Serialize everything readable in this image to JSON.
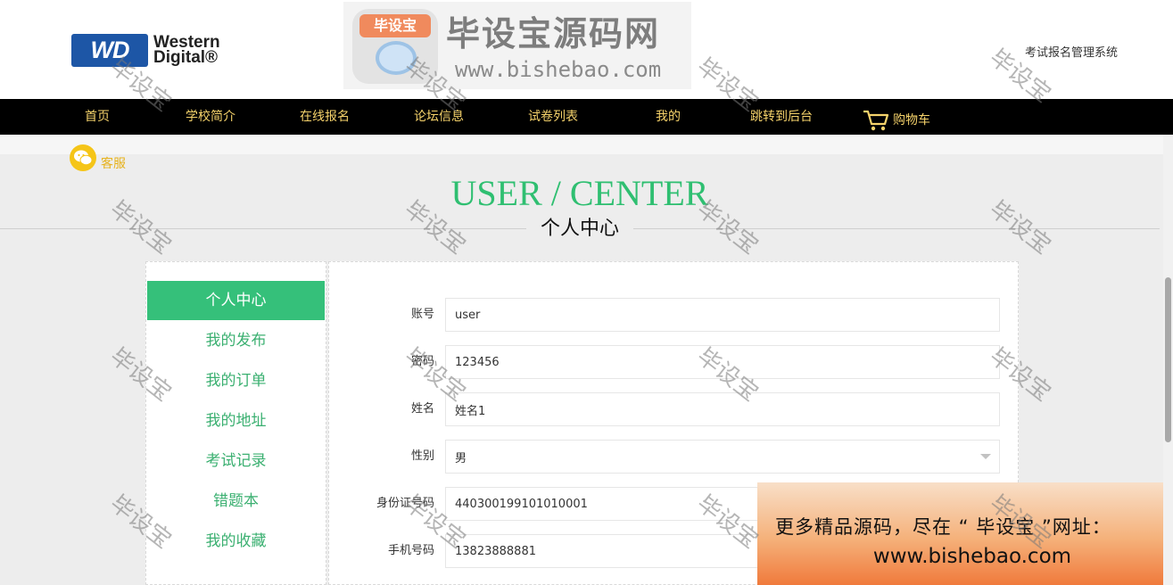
{
  "brand": {
    "logo_mark": "WD",
    "logo_name_line1": "Western",
    "logo_name_line2": "Digital®"
  },
  "banner": {
    "badge": "毕设宝",
    "title": "毕设宝源码网",
    "url": "www.bishebao.com"
  },
  "system_title": "考试报名管理系统",
  "nav": {
    "items": [
      "首页",
      "学校简介",
      "在线报名",
      "论坛信息",
      "试卷列表",
      "我的",
      "跳转到后台"
    ],
    "cart_label": "购物车"
  },
  "service": {
    "label": "客服",
    "icon": "wechat-icon"
  },
  "page_heading": {
    "en": "USER / CENTER",
    "cn": "个人中心"
  },
  "sidebar": {
    "items": [
      "个人中心",
      "我的发布",
      "我的订单",
      "我的地址",
      "考试记录",
      "错题本",
      "我的收藏"
    ],
    "active_index": 0
  },
  "form": {
    "fields": [
      {
        "label": "账号",
        "value": "user",
        "type": "text"
      },
      {
        "label": "密码",
        "value": "123456",
        "type": "text"
      },
      {
        "label": "姓名",
        "value": "姓名1",
        "type": "text"
      },
      {
        "label": "性别",
        "value": "男",
        "type": "select"
      },
      {
        "label": "身份证号码",
        "value": "440300199101010001",
        "type": "text"
      },
      {
        "label": "手机号码",
        "value": "13823888881",
        "type": "text"
      }
    ]
  },
  "ad": {
    "line1": "更多精品源码，尽在 “ 毕设宝 ”网址：",
    "line2": "www.bishebao.com"
  },
  "watermark": "毕设宝",
  "colors": {
    "accent_green": "#35c07a",
    "nav_bg": "#000000",
    "nav_text": "#f6d36b",
    "wd_blue": "#1d56a6"
  }
}
